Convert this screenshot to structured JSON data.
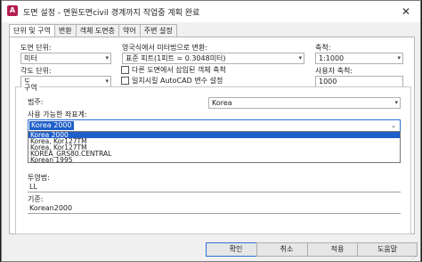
{
  "window": {
    "title": "도면 설정 - 면원도면civil 경계까지 작업중 계획 완료",
    "icon_glyph": "A",
    "close_glyph": "✕"
  },
  "tabs": [
    {
      "label": "단위 및 구역",
      "active": true
    },
    {
      "label": "변환",
      "active": false
    },
    {
      "label": "객체 도면층",
      "active": false
    },
    {
      "label": "약어",
      "active": false
    },
    {
      "label": "주변 설정",
      "active": false
    }
  ],
  "units": {
    "drawing_units_label": "도면 단위:",
    "drawing_units_value": "미터",
    "angle_units_label": "각도 단위:",
    "angle_units_value": "도",
    "imperial_label": "영국식에서 미터법으로 변환:",
    "imperial_value": "표준 피트(1피트 = 0.3048미터)",
    "scale_label": "축척:",
    "scale_value": "1:1000",
    "custom_scale_label": "사용자 축척:",
    "custom_scale_value": "1000",
    "scale_objects_label": "다른 도면에서 삽입된 객체 축척",
    "scale_objects_checked": false,
    "match_autocad_label": "일치시킬 AutoCAD 변수 설정",
    "match_autocad_checked": false
  },
  "zone": {
    "group_label": "구역",
    "category_label": "범주:",
    "category_value": "Korea",
    "coord_system_label": "사용 가능한 좌표계:",
    "coord_system_value": "Korea 2000",
    "dropdown_options": [
      {
        "label": "Korea 2000",
        "selected": true
      },
      {
        "label": "Korea, Kor127TM",
        "selected": false
      },
      {
        "label": "Korea, Kor127TM",
        "selected": false
      },
      {
        "label": "KOREA_GRS80.CENTRAL",
        "selected": false
      },
      {
        "label": "Korean 1995",
        "selected": false
      }
    ],
    "projection_label": "투영법:",
    "projection_value": "LL",
    "datum_label": "기준:",
    "datum_value": "Korean2000"
  },
  "buttons": {
    "ok": "확인",
    "cancel": "취소",
    "apply": "적용",
    "help": "도움말"
  },
  "colors": {
    "selection": "#1f5fc9",
    "focus_border": "#2f6fd6"
  }
}
